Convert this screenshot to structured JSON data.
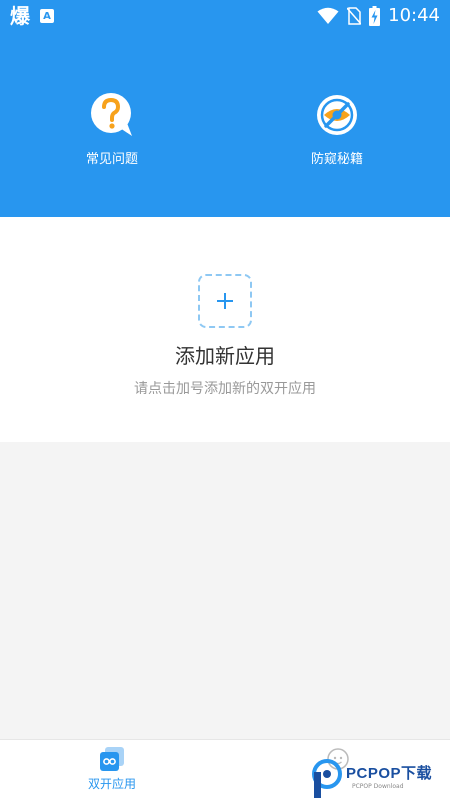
{
  "status_bar": {
    "app_glyph": "爆",
    "notif_letter": "A",
    "time": "10:44",
    "icons": [
      "wifi-icon",
      "no-sim-icon",
      "battery-charging-icon"
    ]
  },
  "header": {
    "tools": [
      {
        "label": "常见问题",
        "icon": "question-bubble-icon"
      },
      {
        "label": "防窥秘籍",
        "icon": "no-eye-icon"
      }
    ]
  },
  "add_app": {
    "icon": "plus-icon",
    "title": "添加新应用",
    "subtitle": "请点击加号添加新的双开应用"
  },
  "bottom_nav": {
    "tabs": [
      {
        "label": "双开应用",
        "icon": "dual-apps-icon",
        "active": true
      },
      {
        "label": "",
        "icon": "profile-icon",
        "active": false
      }
    ]
  },
  "watermark": {
    "text": "PCPOP下载",
    "subtext": "PCPOP Download"
  },
  "colors": {
    "primary": "#2896ef",
    "faq_accent": "#f7a21c",
    "background": "#f4f4f4"
  }
}
